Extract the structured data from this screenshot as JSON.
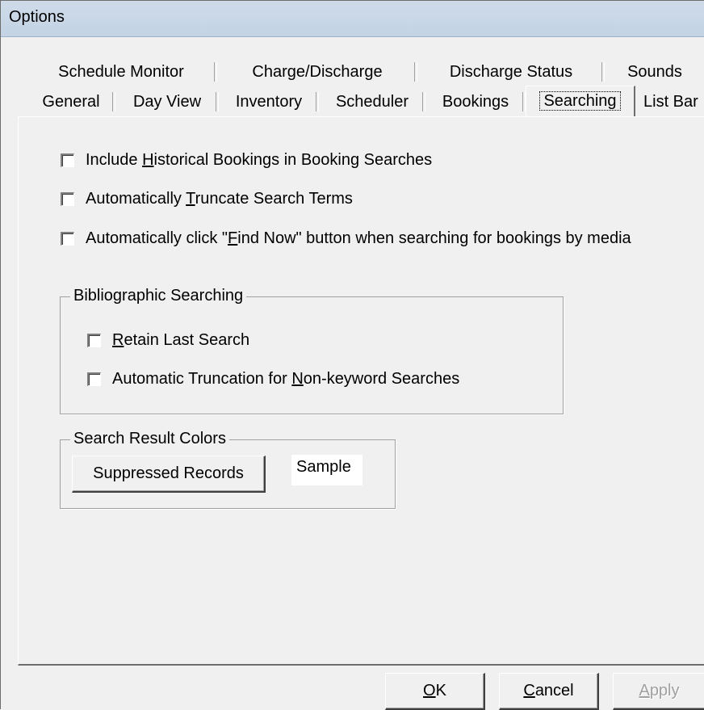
{
  "window": {
    "title": "Options"
  },
  "tabs": {
    "row_back": [
      "Schedule Monitor",
      "Charge/Discharge",
      "Discharge Status",
      "Sounds"
    ],
    "row_front": [
      "General",
      "Day View",
      "Inventory",
      "Scheduler",
      "Bookings",
      "Searching",
      "List Bar"
    ],
    "selected": "Searching"
  },
  "searching": {
    "include_historical": {
      "pre": "Include ",
      "key": "H",
      "post": "istorical Bookings in Booking Searches",
      "checked": false
    },
    "auto_truncate": {
      "pre": "Automatically ",
      "key": "T",
      "post": "runcate Search Terms",
      "checked": false
    },
    "auto_find_now": {
      "pre": "Automatically click \"",
      "key": "F",
      "post": "ind Now\" button when searching for bookings by media",
      "checked": false
    }
  },
  "bibliographic": {
    "legend": "Bibliographic Searching",
    "retain_last": {
      "pre": "",
      "key": "R",
      "post": "etain Last Search",
      "checked": false
    },
    "auto_truncation": {
      "pre": "Automatic Truncation for ",
      "key": "N",
      "post": "on-keyword Searches",
      "checked": false
    }
  },
  "colors": {
    "legend": "Search Result Colors",
    "suppressed_button": "Suppressed Records",
    "sample": "Sample"
  },
  "buttons": {
    "ok": {
      "key": "O",
      "post": "K"
    },
    "cancel": {
      "key": "C",
      "post": "ancel"
    },
    "apply": {
      "key": "A",
      "post": "pply",
      "disabled": true
    }
  }
}
